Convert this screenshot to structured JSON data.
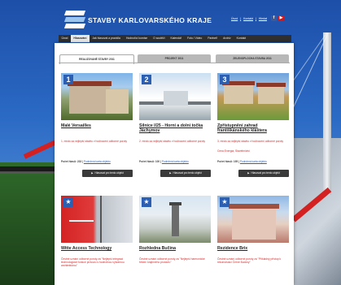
{
  "header": {
    "title": "STAVBY KARLOVARSKÉHO KRAJE",
    "links": [
      "Úvod",
      "Kontakt",
      "Hledat"
    ],
    "social": [
      "f",
      "▶"
    ]
  },
  "nav": {
    "items": [
      "Úvod",
      "Hlasování",
      "Jak hlasovat a pravidla",
      "Hodnotící komise",
      "O soutěži",
      "Kalendář",
      "Foto / Video",
      "Partneři",
      "Archiv",
      "Kontakt"
    ],
    "active_index": 1
  },
  "tabs": [
    "REALIZOVANÉ STAVBY 2011",
    "PROJEKT 2011",
    "ZELENOPLOCHA STAVBA 2011"
  ],
  "cards": [
    {
      "badge": "1",
      "title": "Malé Versailles",
      "desc": "1. místo za nejlepší stavbu v hodnocení odborné poroty",
      "extra": "",
      "votes_label": "Počet hlasů: 233 |",
      "votes_link": "Podrobná karta objektu",
      "button": "Hlasovat pro tento objekt"
    },
    {
      "badge": "2",
      "title": "Silnice I/25 - Horní a dolní točka Jáchymov",
      "desc": "2. místo za nejlepší stavbu v hodnocení odborné poroty",
      "extra": "",
      "votes_label": "Počet hlasů: 100 |",
      "votes_link": "Podrobná karta objektu",
      "button": "Hlasovat pro tento objekt"
    },
    {
      "badge": "3",
      "title": "Zpřístupnění zahrad františkánského kláštera",
      "desc": "3. místo za nejlepší stavbu v hodnocení odborné poroty",
      "extra": "Cena Energia, Stavebnictví",
      "votes_label": "Počet hlasů: 195 |",
      "votes_link": "Podrobná karta objektu",
      "button": "Hlasovat pro tento objekt"
    },
    {
      "badge": "★",
      "title": "Witte Access Technology",
      "desc": "Čestné uznání odborné poroty za \"Nejlepší integraci technologické funkce provozu s hodnotnou výtvarnou architekturou\"",
      "extra": "",
      "votes_label": "",
      "votes_link": "",
      "button": ""
    },
    {
      "badge": "★",
      "title": "Rozhledna Bučina",
      "desc": "Čestné uznání odborné poroty za \"Nejlepší harmonické řešení krajinného prostoru\"",
      "extra": "",
      "votes_label": "",
      "votes_link": "",
      "button": ""
    },
    {
      "badge": "★",
      "title": "Rezidence Brix",
      "desc": "Čestné uznání odborné poroty za \"Příkladný přístup k rekonstrukci Černé Budovy\"",
      "extra": "",
      "votes_label": "",
      "votes_link": "",
      "button": ""
    }
  ]
}
